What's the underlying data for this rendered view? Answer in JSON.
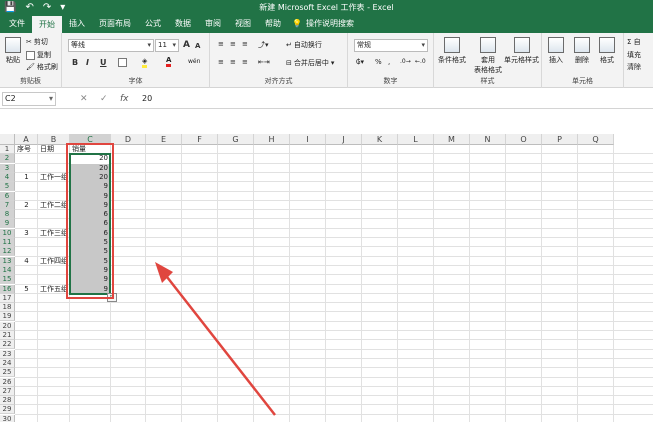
{
  "window": {
    "title": "新建 Microsoft Excel 工作表 - Excel",
    "accent": "#217346"
  },
  "quick_access": {
    "save": "💾",
    "undo": "↶",
    "redo": "↷",
    "more": "▾"
  },
  "menu": {
    "tabs": [
      "文件",
      "开始",
      "插入",
      "页面布局",
      "公式",
      "数据",
      "审阅",
      "视图",
      "帮助"
    ],
    "active": "开始",
    "tellme": "操作说明搜索"
  },
  "ribbon": {
    "clipboard": {
      "paste": "粘贴",
      "cut": "剪切",
      "copy": "复制",
      "painter": "格式刷",
      "label": "剪贴板"
    },
    "font": {
      "name": "等线",
      "size": "11",
      "bold": "B",
      "italic": "I",
      "underline": "U",
      "label": "字体",
      "grow": "A",
      "shrink": "A",
      "wen": "wén"
    },
    "alignment": {
      "wrap": "自动换行",
      "merge": "合并后居中",
      "label": "对齐方式"
    },
    "number": {
      "format": "常规",
      "percent": "%",
      "comma": ",",
      "label": "数字"
    },
    "styles": {
      "conditional": "条件格式",
      "table": "套用\n表格格式",
      "cell": "单元格样式",
      "label": "样式"
    },
    "cells": {
      "insert": "插入",
      "delete": "删除",
      "format": "格式",
      "label": "单元格"
    },
    "editing": {
      "sum": "Σ 自",
      "fill": "填充",
      "clear": "清除"
    }
  },
  "formula_bar": {
    "name_box": "C2",
    "cancel": "✕",
    "enter": "✓",
    "fx": "fx",
    "value": "20"
  },
  "columns": [
    "A",
    "B",
    "C",
    "D",
    "E",
    "F",
    "G",
    "H",
    "I",
    "J",
    "K",
    "L",
    "M",
    "N",
    "O",
    "P",
    "Q"
  ],
  "selected_column": "C",
  "rows": [
    "1",
    "2",
    "3",
    "4",
    "5",
    "6",
    "7",
    "8",
    "9",
    "10",
    "11",
    "12",
    "13",
    "14",
    "15",
    "16",
    "17",
    "18",
    "19",
    "20",
    "21",
    "22",
    "23",
    "24",
    "25",
    "26",
    "27",
    "28",
    "29",
    "30"
  ],
  "headers": {
    "A1": "序号",
    "B1": "日期",
    "C1": "销量"
  },
  "groups": [
    {
      "a": "1",
      "b": "工作一组",
      "row": 4
    },
    {
      "a": "2",
      "b": "工作二组",
      "row": 7
    },
    {
      "a": "3",
      "b": "工作三组",
      "row": 10
    },
    {
      "a": "4",
      "b": "工作四组",
      "row": 13
    },
    {
      "a": "5",
      "b": "工作五组",
      "row": 16
    }
  ],
  "column_c": [
    "20",
    "20",
    "20",
    "9",
    "9",
    "9",
    "6",
    "6",
    "6",
    "5",
    "5",
    "5",
    "9",
    "9",
    "9"
  ],
  "quick_analysis": "⊞"
}
